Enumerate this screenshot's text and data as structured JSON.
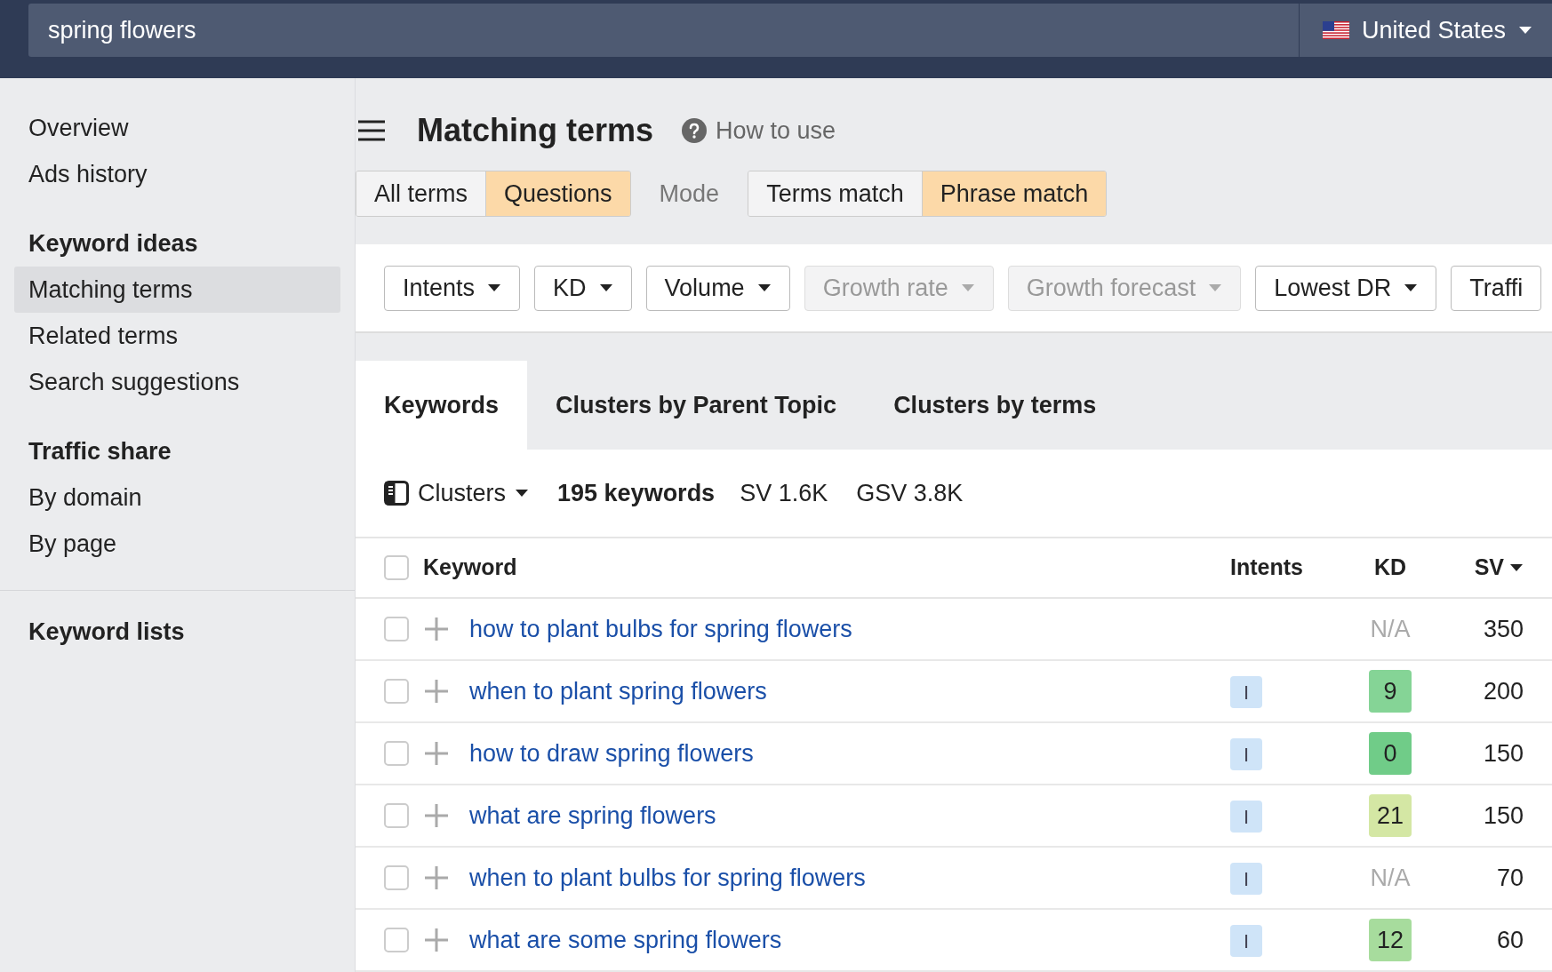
{
  "search": {
    "value": "spring flowers"
  },
  "country": {
    "label": "United States"
  },
  "sidebar": {
    "groups": [
      {
        "items": [
          {
            "label": "Overview",
            "selected": false
          },
          {
            "label": "Ads history",
            "selected": false
          }
        ]
      },
      {
        "heading": "Keyword ideas",
        "items": [
          {
            "label": "Matching terms",
            "selected": true
          },
          {
            "label": "Related terms",
            "selected": false
          },
          {
            "label": "Search suggestions",
            "selected": false
          }
        ]
      },
      {
        "heading": "Traffic share",
        "items": [
          {
            "label": "By domain",
            "selected": false
          },
          {
            "label": "By page",
            "selected": false
          }
        ]
      }
    ],
    "footer_heading": "Keyword lists"
  },
  "header": {
    "title": "Matching terms",
    "help_link": "How to use"
  },
  "term_filter": [
    {
      "label": "All terms",
      "selected": false
    },
    {
      "label": "Questions",
      "selected": true
    }
  ],
  "mode": {
    "label": "Mode",
    "options": [
      {
        "label": "Terms match",
        "selected": false
      },
      {
        "label": "Phrase match",
        "selected": true
      }
    ]
  },
  "filter_buttons": [
    {
      "label": "Intents",
      "disabled": false
    },
    {
      "label": "KD",
      "disabled": false
    },
    {
      "label": "Volume",
      "disabled": false
    },
    {
      "label": "Growth rate",
      "disabled": true
    },
    {
      "label": "Growth forecast",
      "disabled": true
    },
    {
      "label": "Lowest DR",
      "disabled": false
    },
    {
      "label": "Traffi",
      "disabled": false
    }
  ],
  "tabs": [
    {
      "label": "Keywords",
      "selected": true
    },
    {
      "label": "Clusters by Parent Topic",
      "selected": false
    },
    {
      "label": "Clusters by terms",
      "selected": false
    }
  ],
  "summary": {
    "clusters": "Clusters",
    "keywords": "195 keywords",
    "sv": "SV 1.6K",
    "gsv": "GSV 3.8K"
  },
  "table": {
    "select_all_checked": false,
    "columns": [
      {
        "label": "Keyword",
        "sorted": false
      },
      {
        "label": "Intents",
        "sorted": false
      },
      {
        "label": "KD",
        "sorted": false
      },
      {
        "label": "SV",
        "sorted": true
      }
    ],
    "rows": [
      {
        "keyword": "how to plant bulbs for spring flowers",
        "checked": false,
        "kd": "N/A",
        "sv": "350"
      },
      {
        "keyword": "when to plant spring flowers",
        "checked": false,
        "intent": "I",
        "kd": "9",
        "color": "#85d496",
        "sv": "200"
      },
      {
        "keyword": "how to draw spring flowers",
        "checked": false,
        "intent": "I",
        "kd": "0",
        "color": "#70cc88",
        "sv": "150"
      },
      {
        "keyword": "what are spring flowers",
        "checked": false,
        "intent": "I",
        "kd": "21",
        "color": "#d4e7a4",
        "sv": "150"
      },
      {
        "keyword": "when to plant bulbs for spring flowers",
        "checked": false,
        "intent": "I",
        "kd": "N/A",
        "sv": "70"
      },
      {
        "keyword": "what are some spring flowers",
        "checked": false,
        "intent": "I",
        "kd": "12",
        "color": "#a7dc9d",
        "sv": "60"
      }
    ]
  }
}
